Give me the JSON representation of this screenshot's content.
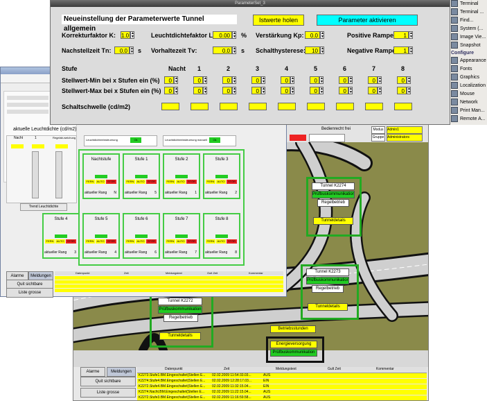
{
  "sys_panel": {
    "items": [
      "Terminal",
      "Terminal ...",
      "Find...",
      "System (...",
      "Image Vie...",
      "Snapshot"
    ],
    "configure_header": "Configure",
    "config_items": [
      "Appearance",
      "Fonts",
      "Graphics",
      "Localization",
      "Mouse",
      "Network",
      "Print Man...",
      "Remote A..."
    ]
  },
  "param": {
    "window_title": "ParameterSet_3",
    "heading": "Neueinstellung der Parameterwerte Tunnel allgemein",
    "btn_ist": "Istwerte holen",
    "btn_activate": "Parameter aktivieren",
    "row1": {
      "kp_label": "Korrekturfaktor K:",
      "kp_value": "1.0",
      "lf_label": "Leuchtdichtefaktor LF:",
      "lf_value": "0.00",
      "lf_unit": "%",
      "vk_label": "Verstärkung Kp:",
      "vk_value": "0.0",
      "pr_label": "Positive Rampe:",
      "pr_value": "1"
    },
    "row2": {
      "tn_label": "Nachstellzeit Tn:",
      "tn_value": "0.0",
      "tn_unit": "s",
      "tv_label": "Vorhaltezeit Tv:",
      "tv_value": "0.0",
      "tv_unit": "s",
      "sh_label": "Schalthysterese:",
      "sh_value": "10",
      "nr_label": "Negative Rampe:",
      "nr_value": "1"
    },
    "stufe_header": "Stufe",
    "stufe_cols": [
      "Nacht",
      "1",
      "2",
      "3",
      "4",
      "5",
      "6",
      "7",
      "8"
    ],
    "min_label": "Stellwert-Min bei x Stufen ein (%)",
    "max_label": "Stellwert-Max bei x Stufen ein (%)",
    "schwelle_label": "Schaltschwelle (cd/m2)",
    "min_values": [
      "0",
      "0",
      "0",
      "0",
      "0",
      "0",
      "0",
      "0",
      "0"
    ],
    "max_values": [
      "0",
      "0",
      "0",
      "0",
      "0",
      "0",
      "0",
      "0",
      "0"
    ]
  },
  "mid": {
    "section_title": "aktuelle Leuchtdichte (cd/m2)",
    "col_labels": [
      "Nacht",
      "1",
      "Regelab-weichung"
    ],
    "btn_trend": "Trend Leuchtdichte",
    "mode_auto": "Leuchtdichteeinsteuerung",
    "mode_manual": "Leuchtdichteeinsteuerung manuell",
    "ok": "Ok",
    "stufen": [
      {
        "name": "Nachtstufe",
        "rang": "N"
      },
      {
        "name": "Stufe 1",
        "rang": "5"
      },
      {
        "name": "Stufe 2",
        "rang": "1"
      },
      {
        "name": "Stufe 3",
        "rang": "2"
      },
      {
        "name": "Stufe 4",
        "rang": "3"
      },
      {
        "name": "Stufe 5",
        "rang": "4"
      },
      {
        "name": "Stufe 6",
        "rang": "6"
      },
      {
        "name": "Stufe 7",
        "rang": "7"
      },
      {
        "name": "Stufe 8",
        "rang": "8"
      }
    ],
    "rang_label": "aktueller Rang",
    "chip_fern": "FERN",
    "chip_auto": "AUTO",
    "chip_stor": "STÖR",
    "tabs": [
      "Alarme",
      "Meldungen"
    ],
    "btn_quit": "Quit sichtbare",
    "btn_liste": "Liste grosse",
    "table_headers": [
      "Datenpunkt",
      "Zeit",
      "Meldungstext",
      "Gult Zeit",
      "Kommentar"
    ]
  },
  "map": {
    "bedienrecht": "Bedienrecht frei",
    "modus_label": "Modus",
    "modus_value": "Admin1",
    "gruppe_label": "Gruppe",
    "gruppe_value": "Administrators",
    "tunnel_k2274": "Tunnel K2274",
    "tunnel_k2273": "Tunnel K2273",
    "tunnel_k2272": "Tunnel K2272",
    "pruef": "Prüfbuskommunikation",
    "regel": "Regelbetrieb",
    "details": "Tunneldetails",
    "betriebsstunden": "Betriebsstunden",
    "energie": "Energieversorgung",
    "pruef2": "Prüfbuskommunikation",
    "tabs": [
      "Alarme",
      "Meldungen"
    ],
    "btn_quit": "Quit sichtbare",
    "btn_liste": "Liste grosse",
    "table_headers": [
      "Datenpunkt",
      "Zeit",
      "Meldungstext",
      "Gult Zeit",
      "Kommentar"
    ],
    "rows": [
      {
        "dp": "K2273.Stufe1.BM.Eingeschaltet(Stellen E...",
        "zeit": "02.02.2009 11:54:33.03...",
        "text": "AUS"
      },
      {
        "dp": "K2274.Stufe4.BM.Eingeschaltet(Stellen E...",
        "zeit": "02.02.2009 12:28:17.03...",
        "text": "EIN"
      },
      {
        "dp": "K2272.Stufe4.BM.Eingeschaltet(Stellen E...",
        "zeit": "02.02.2009 11:32:15.04...",
        "text": "EIN"
      },
      {
        "dp": "K2274.Nacht.BM.Eingeschaltet(Stellen E...",
        "zeit": "02.02.2009 11:22:15.04...",
        "text": "AUS"
      },
      {
        "dp": "K2272.Stufe3.BM.Eingeschaltet(Stellen E...",
        "zeit": "02.02.2009 11:16:59.58...",
        "text": "AUS"
      }
    ]
  }
}
